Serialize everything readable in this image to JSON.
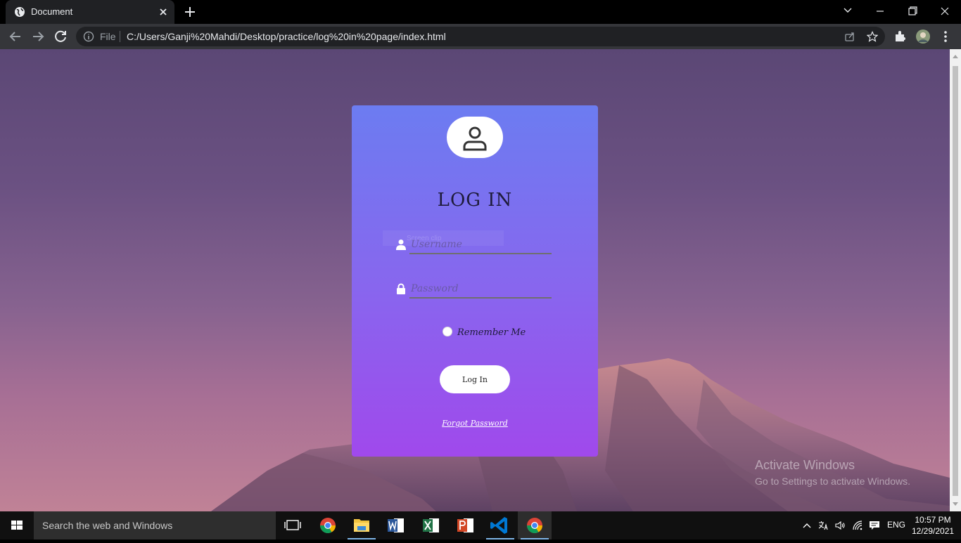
{
  "browser": {
    "tab_title": "Document",
    "address_prefix": "File",
    "url": "C:/Users/Ganji%20Mahdi/Desktop/practice/log%20in%20page/index.html"
  },
  "login": {
    "title": "LOG IN",
    "username_placeholder": "Username",
    "password_placeholder": "Password",
    "remember_label": "Remember Me",
    "button_label": "Log In",
    "forgot_link": "Forgot Password",
    "ghost_text": "Screen clip"
  },
  "watermark": {
    "line1": "Activate Windows",
    "line2": "Go to Settings to activate Windows."
  },
  "taskbar": {
    "search_placeholder": "Search the web and Windows",
    "language": "ENG",
    "time": "10:57 PM",
    "date": "12/29/2021"
  },
  "colors": {
    "card_top": "#6c7cf1",
    "card_bottom": "#a049ec",
    "chrome_dark": "#202124",
    "chrome_toolbar": "#35363a"
  }
}
